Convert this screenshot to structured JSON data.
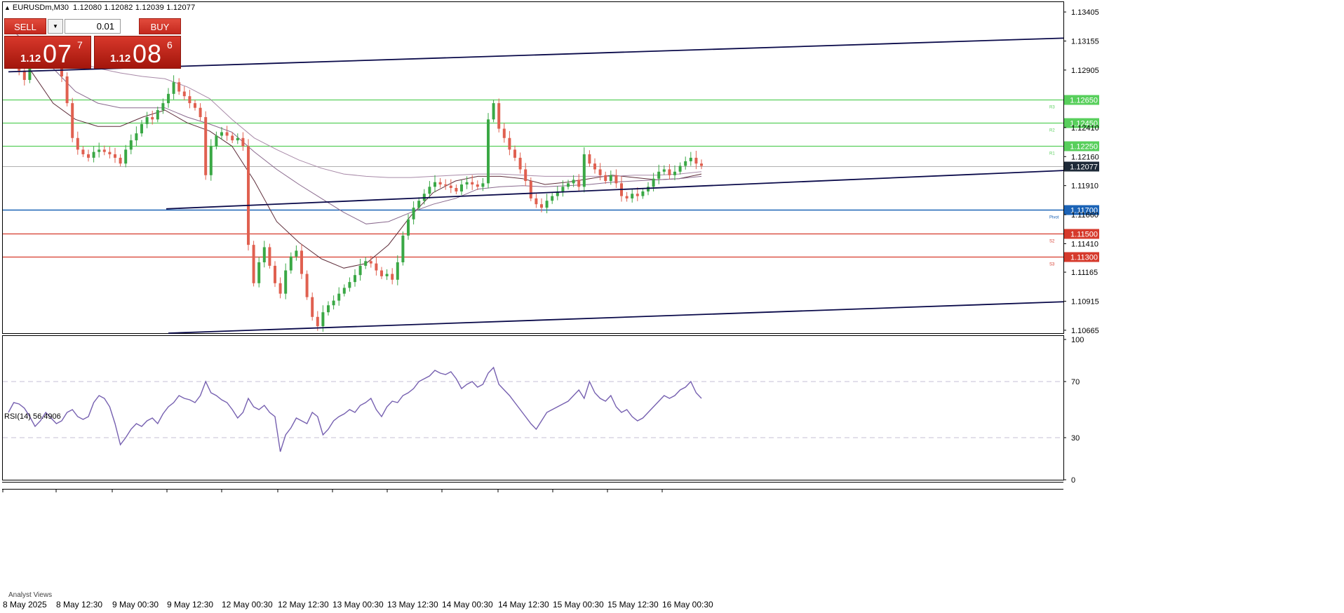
{
  "header": {
    "symbol": "EURUSDm,M30",
    "ohlc": "1.12080 1.12082 1.12039 1.12077"
  },
  "trade_panel": {
    "sell_label": "SELL",
    "buy_label": "BUY",
    "lot": "0.01",
    "sell_prefix": "1.12",
    "sell_big": "07",
    "sell_sup": "7",
    "buy_prefix": "1.12",
    "buy_big": "08",
    "buy_sup": "6"
  },
  "indicator": {
    "rsi_label": "RSI(14) 56.4906"
  },
  "footer": {
    "panel_tab": "Analyst Views"
  },
  "colors": {
    "bull": "#3aa845",
    "bear": "#e06050",
    "resistance": "#58cf5c",
    "pivot": "#1b63b6",
    "support": "#d63a2c",
    "trend": "#0a0a4a",
    "rsi": "#7660b0",
    "ma_fast": "#5e2d3a",
    "ma_mid": "#8a6a8e",
    "ma_slow": "#a88aa8"
  },
  "chart_data": {
    "type": "candlestick",
    "symbol": "EURUSDm",
    "timeframe": "M30",
    "x_labels": [
      "8 May 2025",
      "8 May 12:30",
      "9 May 00:30",
      "9 May 12:30",
      "12 May 00:30",
      "12 May 12:30",
      "13 May 00:30",
      "13 May 12:30",
      "14 May 00:30",
      "14 May 12:30",
      "15 May 00:30",
      "15 May 12:30",
      "16 May 00:30"
    ],
    "price_axis": {
      "ticks": [
        "1.13405",
        "1.13155",
        "1.12905",
        "1.12410",
        "1.12160",
        "1.11910",
        "1.11660",
        "1.11410",
        "1.11165",
        "1.10915",
        "1.10665"
      ],
      "ylim": [
        1.1064,
        1.1349
      ]
    },
    "horizontal_levels": [
      {
        "tag": "R3",
        "price": 1.1265,
        "label": "1.12650",
        "kind": "resistance"
      },
      {
        "tag": "R2",
        "price": 1.1245,
        "label": "1.12450",
        "kind": "resistance"
      },
      {
        "tag": "R1",
        "price": 1.1225,
        "label": "1.12250",
        "kind": "resistance"
      },
      {
        "tag": "Pivot",
        "price": 1.117,
        "label": "1.11700",
        "kind": "pivot"
      },
      {
        "tag": "S2",
        "price": 1.115,
        "label": "1.11500",
        "kind": "support"
      },
      {
        "tag": "S3",
        "price": 1.113,
        "label": "1.11300",
        "kind": "support"
      }
    ],
    "current_price": {
      "price": 1.12077,
      "label": "1.12077"
    },
    "close_series": [
      1.1307,
      1.13,
      1.129,
      1.1282,
      1.1296,
      1.1302,
      1.131,
      1.1312,
      1.1305,
      1.13,
      1.1285,
      1.1262,
      1.1232,
      1.1222,
      1.1218,
      1.1215,
      1.122,
      1.1222,
      1.122,
      1.1218,
      1.1215,
      1.121,
      1.1222,
      1.123,
      1.1236,
      1.1244,
      1.125,
      1.1248,
      1.1256,
      1.1262,
      1.127,
      1.128,
      1.1272,
      1.1268,
      1.1262,
      1.1258,
      1.125,
      1.12,
      1.1225,
      1.1234,
      1.1237,
      1.1234,
      1.123,
      1.1232,
      1.1225,
      1.114,
      1.1107,
      1.1125,
      1.1138,
      1.1122,
      1.1107,
      1.1098,
      1.1118,
      1.113,
      1.1135,
      1.1115,
      1.1095,
      1.1078,
      1.107,
      1.1082,
      1.1088,
      1.1092,
      1.1098,
      1.1103,
      1.1108,
      1.1114,
      1.1122,
      1.1126,
      1.1124,
      1.1118,
      1.1113,
      1.1115,
      1.111,
      1.1125,
      1.1148,
      1.1162,
      1.1172,
      1.1178,
      1.1184,
      1.119,
      1.1194,
      1.1192,
      1.1191,
      1.1189,
      1.1186,
      1.1192,
      1.1194,
      1.1192,
      1.119,
      1.1193,
      1.1248,
      1.1262,
      1.124,
      1.1232,
      1.1222,
      1.1215,
      1.1205,
      1.1195,
      1.118,
      1.1175,
      1.1172,
      1.1178,
      1.1182,
      1.1186,
      1.119,
      1.1193,
      1.1196,
      1.119,
      1.1218,
      1.121,
      1.1205,
      1.12,
      1.1195,
      1.12,
      1.1193,
      1.1182,
      1.118,
      1.1184,
      1.1182,
      1.1186,
      1.119,
      1.1197,
      1.1203,
      1.1205,
      1.12,
      1.1203,
      1.1208,
      1.1212,
      1.1215,
      1.121,
      1.1208
    ],
    "moving_averages": [
      {
        "name": "MA fast",
        "color": "#5e2d3a",
        "values": [
          1.1318,
          1.129,
          1.1262,
          1.1248,
          1.1242,
          1.1242,
          1.125,
          1.1256,
          1.1245,
          1.1238,
          1.1225,
          1.1195,
          1.116,
          1.1142,
          1.1128,
          1.112,
          1.1124,
          1.114,
          1.1165,
          1.1185,
          1.1195,
          1.1199,
          1.1199,
          1.1197,
          1.1192,
          1.1194,
          1.1197,
          1.12,
          1.1198,
          1.1196,
          1.1197,
          1.1201
        ]
      },
      {
        "name": "MA mid",
        "color": "#8a6a8e",
        "values": [
          1.1328,
          1.131,
          1.1292,
          1.1272,
          1.1262,
          1.1258,
          1.1258,
          1.1258,
          1.125,
          1.1244,
          1.1237,
          1.122,
          1.1205,
          1.1192,
          1.118,
          1.1168,
          1.1158,
          1.116,
          1.1168,
          1.1175,
          1.118,
          1.1188,
          1.119,
          1.1191,
          1.119,
          1.1191,
          1.1192,
          1.1194,
          1.1195,
          1.1196,
          1.1197,
          1.1199
        ]
      },
      {
        "name": "MA slow",
        "color": "#a88aa8",
        "values": [
          1.1318,
          1.1312,
          1.1306,
          1.1298,
          1.1292,
          1.1288,
          1.1285,
          1.1283,
          1.1276,
          1.1266,
          1.1248,
          1.1232,
          1.1222,
          1.1213,
          1.1206,
          1.1201,
          1.1199,
          1.1198,
          1.1198,
          1.1199,
          1.12,
          1.1201,
          1.1201,
          1.12,
          1.1199,
          1.1199,
          1.1199,
          1.1199,
          1.12,
          1.12,
          1.1201,
          1.1203
        ]
      }
    ],
    "rsi": {
      "name": "RSI(14)",
      "last_value": 56.4906,
      "levels": [
        70,
        30
      ],
      "ylim": [
        0,
        100
      ],
      "ticks": [
        "100",
        "70",
        "30",
        "0"
      ],
      "values": [
        48,
        55,
        54,
        51,
        45,
        38,
        42,
        48,
        44,
        40,
        42,
        48,
        50,
        45,
        43,
        45,
        55,
        60,
        58,
        52,
        40,
        25,
        30,
        36,
        40,
        38,
        42,
        44,
        40,
        47,
        52,
        55,
        60,
        58,
        57,
        55,
        60,
        70,
        62,
        60,
        57,
        55,
        50,
        44,
        48,
        58,
        52,
        50,
        53,
        48,
        45,
        20,
        32,
        37,
        44,
        42,
        40,
        48,
        45,
        32,
        36,
        42,
        45,
        47,
        50,
        48,
        53,
        55,
        58,
        50,
        45,
        52,
        56,
        55,
        60,
        62,
        65,
        70,
        72,
        74,
        78,
        76,
        75,
        77,
        72,
        65,
        68,
        70,
        66,
        68,
        76,
        80,
        68,
        64,
        60,
        55,
        50,
        45,
        40,
        36,
        42,
        48,
        50,
        52,
        54,
        56,
        60,
        64,
        58,
        70,
        62,
        58,
        56,
        60,
        52,
        48,
        50,
        45,
        42,
        44,
        48,
        52,
        56,
        60,
        58,
        60,
        64,
        66,
        70,
        62,
        58
      ]
    },
    "trend_lines": [
      {
        "role": "upper channel",
        "start": {
          "index": 0,
          "price": 1.1289
        },
        "end": {
          "index": 150,
          "price": 1.1318
        }
      },
      {
        "role": "middle channel",
        "start": {
          "index": 0,
          "price": 1.1171
        },
        "end": {
          "index": 150,
          "price": 1.1204
        }
      },
      {
        "role": "lower channel",
        "start": {
          "index": 30,
          "price": 1.1064
        },
        "end": {
          "index": 150,
          "price": 1.1091
        }
      }
    ]
  }
}
